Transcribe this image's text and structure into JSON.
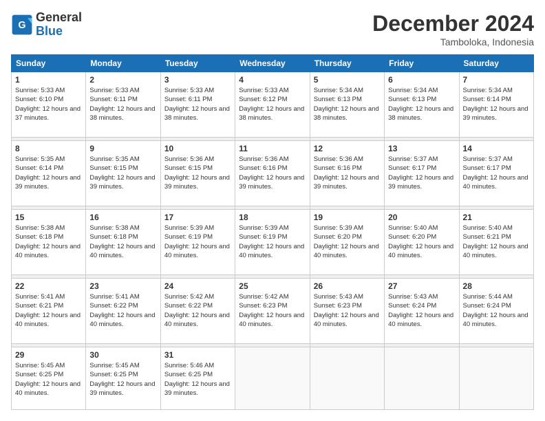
{
  "logo": {
    "text_general": "General",
    "text_blue": "Blue"
  },
  "title": "December 2024",
  "subtitle": "Tamboloka, Indonesia",
  "weekdays": [
    "Sunday",
    "Monday",
    "Tuesday",
    "Wednesday",
    "Thursday",
    "Friday",
    "Saturday"
  ],
  "weeks": [
    [
      {
        "day": "1",
        "sunrise": "5:33 AM",
        "sunset": "6:10 PM",
        "daylight": "12 hours and 37 minutes."
      },
      {
        "day": "2",
        "sunrise": "5:33 AM",
        "sunset": "6:11 PM",
        "daylight": "12 hours and 38 minutes."
      },
      {
        "day": "3",
        "sunrise": "5:33 AM",
        "sunset": "6:11 PM",
        "daylight": "12 hours and 38 minutes."
      },
      {
        "day": "4",
        "sunrise": "5:33 AM",
        "sunset": "6:12 PM",
        "daylight": "12 hours and 38 minutes."
      },
      {
        "day": "5",
        "sunrise": "5:34 AM",
        "sunset": "6:13 PM",
        "daylight": "12 hours and 38 minutes."
      },
      {
        "day": "6",
        "sunrise": "5:34 AM",
        "sunset": "6:13 PM",
        "daylight": "12 hours and 38 minutes."
      },
      {
        "day": "7",
        "sunrise": "5:34 AM",
        "sunset": "6:14 PM",
        "daylight": "12 hours and 39 minutes."
      }
    ],
    [
      {
        "day": "8",
        "sunrise": "5:35 AM",
        "sunset": "6:14 PM",
        "daylight": "12 hours and 39 minutes."
      },
      {
        "day": "9",
        "sunrise": "5:35 AM",
        "sunset": "6:15 PM",
        "daylight": "12 hours and 39 minutes."
      },
      {
        "day": "10",
        "sunrise": "5:36 AM",
        "sunset": "6:15 PM",
        "daylight": "12 hours and 39 minutes."
      },
      {
        "day": "11",
        "sunrise": "5:36 AM",
        "sunset": "6:16 PM",
        "daylight": "12 hours and 39 minutes."
      },
      {
        "day": "12",
        "sunrise": "5:36 AM",
        "sunset": "6:16 PM",
        "daylight": "12 hours and 39 minutes."
      },
      {
        "day": "13",
        "sunrise": "5:37 AM",
        "sunset": "6:17 PM",
        "daylight": "12 hours and 39 minutes."
      },
      {
        "day": "14",
        "sunrise": "5:37 AM",
        "sunset": "6:17 PM",
        "daylight": "12 hours and 40 minutes."
      }
    ],
    [
      {
        "day": "15",
        "sunrise": "5:38 AM",
        "sunset": "6:18 PM",
        "daylight": "12 hours and 40 minutes."
      },
      {
        "day": "16",
        "sunrise": "5:38 AM",
        "sunset": "6:18 PM",
        "daylight": "12 hours and 40 minutes."
      },
      {
        "day": "17",
        "sunrise": "5:39 AM",
        "sunset": "6:19 PM",
        "daylight": "12 hours and 40 minutes."
      },
      {
        "day": "18",
        "sunrise": "5:39 AM",
        "sunset": "6:19 PM",
        "daylight": "12 hours and 40 minutes."
      },
      {
        "day": "19",
        "sunrise": "5:39 AM",
        "sunset": "6:20 PM",
        "daylight": "12 hours and 40 minutes."
      },
      {
        "day": "20",
        "sunrise": "5:40 AM",
        "sunset": "6:20 PM",
        "daylight": "12 hours and 40 minutes."
      },
      {
        "day": "21",
        "sunrise": "5:40 AM",
        "sunset": "6:21 PM",
        "daylight": "12 hours and 40 minutes."
      }
    ],
    [
      {
        "day": "22",
        "sunrise": "5:41 AM",
        "sunset": "6:21 PM",
        "daylight": "12 hours and 40 minutes."
      },
      {
        "day": "23",
        "sunrise": "5:41 AM",
        "sunset": "6:22 PM",
        "daylight": "12 hours and 40 minutes."
      },
      {
        "day": "24",
        "sunrise": "5:42 AM",
        "sunset": "6:22 PM",
        "daylight": "12 hours and 40 minutes."
      },
      {
        "day": "25",
        "sunrise": "5:42 AM",
        "sunset": "6:23 PM",
        "daylight": "12 hours and 40 minutes."
      },
      {
        "day": "26",
        "sunrise": "5:43 AM",
        "sunset": "6:23 PM",
        "daylight": "12 hours and 40 minutes."
      },
      {
        "day": "27",
        "sunrise": "5:43 AM",
        "sunset": "6:24 PM",
        "daylight": "12 hours and 40 minutes."
      },
      {
        "day": "28",
        "sunrise": "5:44 AM",
        "sunset": "6:24 PM",
        "daylight": "12 hours and 40 minutes."
      }
    ],
    [
      {
        "day": "29",
        "sunrise": "5:45 AM",
        "sunset": "6:25 PM",
        "daylight": "12 hours and 40 minutes."
      },
      {
        "day": "30",
        "sunrise": "5:45 AM",
        "sunset": "6:25 PM",
        "daylight": "12 hours and 39 minutes."
      },
      {
        "day": "31",
        "sunrise": "5:46 AM",
        "sunset": "6:25 PM",
        "daylight": "12 hours and 39 minutes."
      },
      null,
      null,
      null,
      null
    ]
  ]
}
